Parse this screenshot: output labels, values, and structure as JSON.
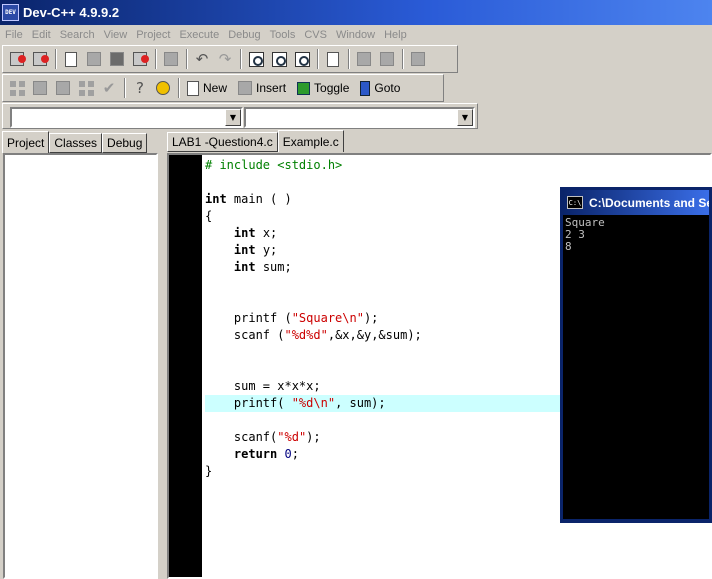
{
  "window": {
    "title": "Dev-C++ 4.9.9.2",
    "app_icon_text": "DEV"
  },
  "menu": [
    "File",
    "Edit",
    "Search",
    "View",
    "Project",
    "Execute",
    "Debug",
    "Tools",
    "CVS",
    "Window",
    "Help"
  ],
  "toolbar2": {
    "new_label": "New",
    "insert_label": "Insert",
    "toggle_label": "Toggle",
    "goto_label": "Goto"
  },
  "left_tabs": [
    "Project",
    "Classes",
    "Debug"
  ],
  "editor_tabs": [
    "LAB1 -Question4.c",
    "Example.c"
  ],
  "code": {
    "l1": "# include <stdio.h>",
    "int": "int",
    "main_rest": " main ( )",
    "open_brace": "{",
    "decl_x": " x;",
    "decl_y": " y;",
    "decl_sum": " sum;",
    "printf1_pre": "printf (",
    "printf1_str": "\"Square\\n\"",
    "printf1_post": ");",
    "scanf1_pre": "scanf (",
    "scanf1_str": "\"%d%d\"",
    "scanf1_post": ",&x,&y,&sum);",
    "sum_line": "sum = x*x*x;",
    "printf2_pre": "printf( ",
    "printf2_str": "\"%d\\n\"",
    "printf2_post": ", sum);",
    "scanf2_pre": "scanf(",
    "scanf2_str": "\"%d\"",
    "scanf2_post": ");",
    "return_kw": "return",
    "return_num": "0",
    "return_post": ";",
    "close_brace": "}"
  },
  "console": {
    "title": "C:\\Documents and Settings",
    "icon_text": "C:\\",
    "lines": [
      "Square",
      "2 3",
      "8"
    ]
  },
  "colors": {
    "title_bar": "#0a246a",
    "highlight_line": "#ccffff",
    "preprocessor": "#008000",
    "string": "#cc0000"
  }
}
